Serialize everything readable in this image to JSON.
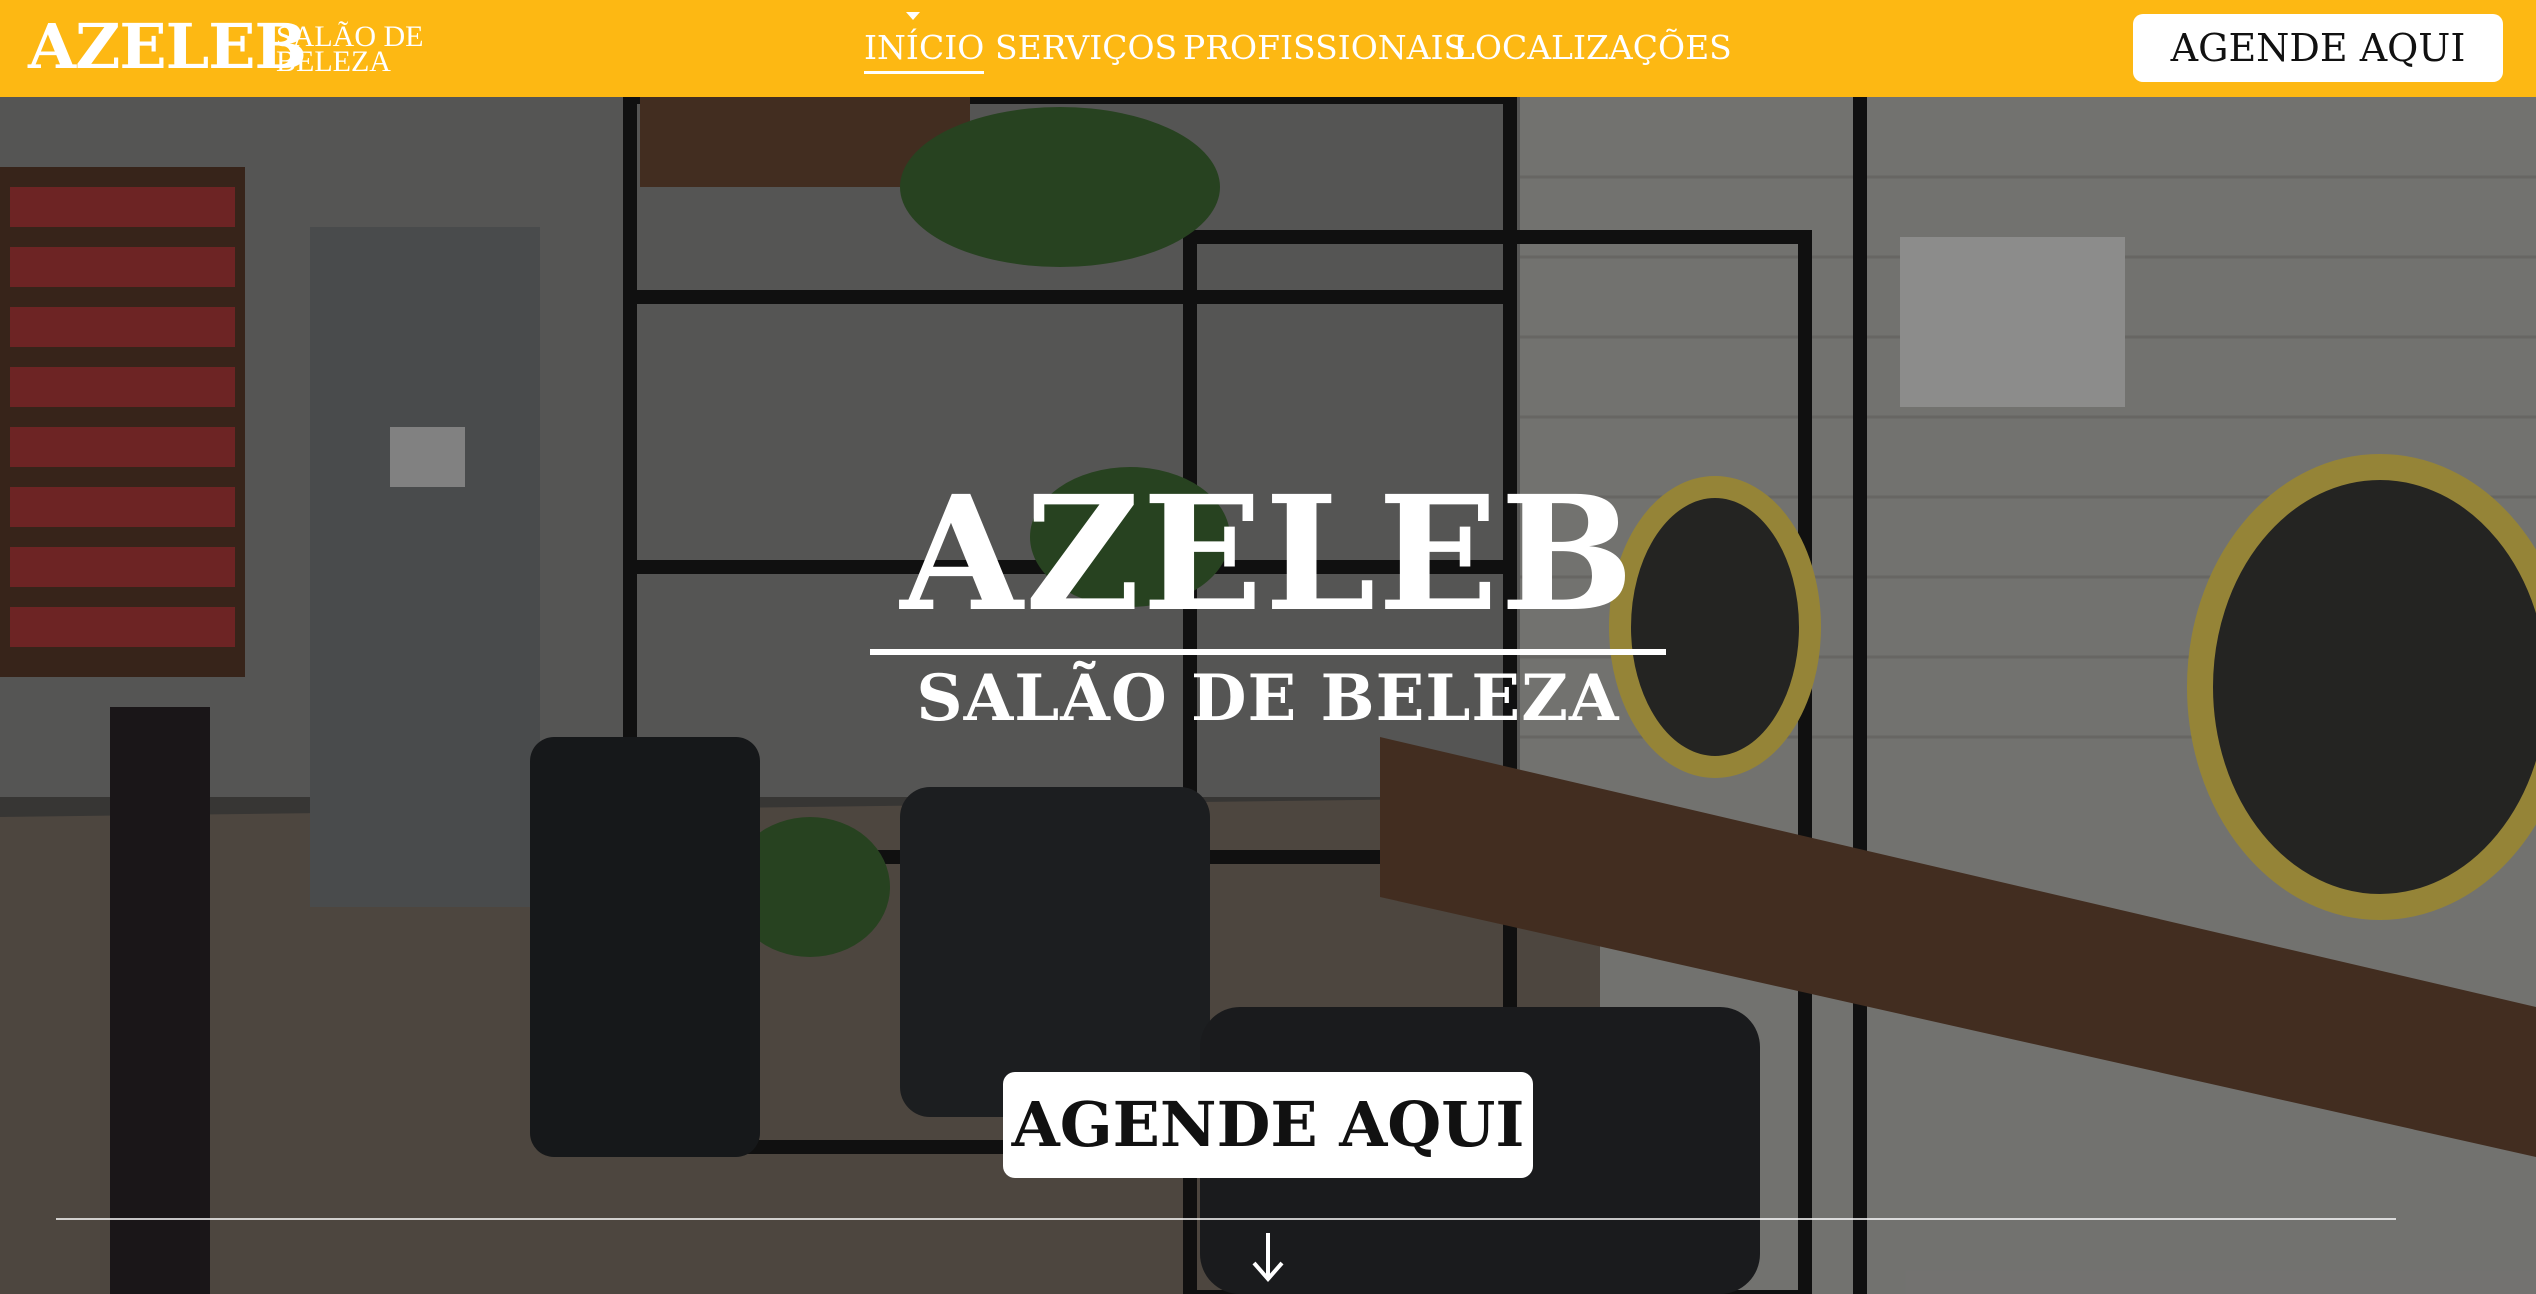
{
  "header": {
    "logo_main": "AZELEB",
    "logo_sub_line1": "SALÃO DE",
    "logo_sub_line2": "BELEZA",
    "nav": [
      {
        "label": "INÍCIO",
        "active": true
      },
      {
        "label": "SERVIÇOS",
        "active": false
      },
      {
        "label": "PROFISSIONAIS",
        "active": false
      },
      {
        "label": "LOCALIZAÇÕES",
        "active": false
      }
    ],
    "cta_label": "AGENDE AQUI",
    "background_color": "#fdb813"
  },
  "hero": {
    "title": "AZELEB",
    "subtitle": "SALÃO DE BELEZA",
    "cta_label": "AGENDE AQUI",
    "scroll_icon": "arrow-down-icon",
    "background_image": "salon-interior-photo"
  }
}
